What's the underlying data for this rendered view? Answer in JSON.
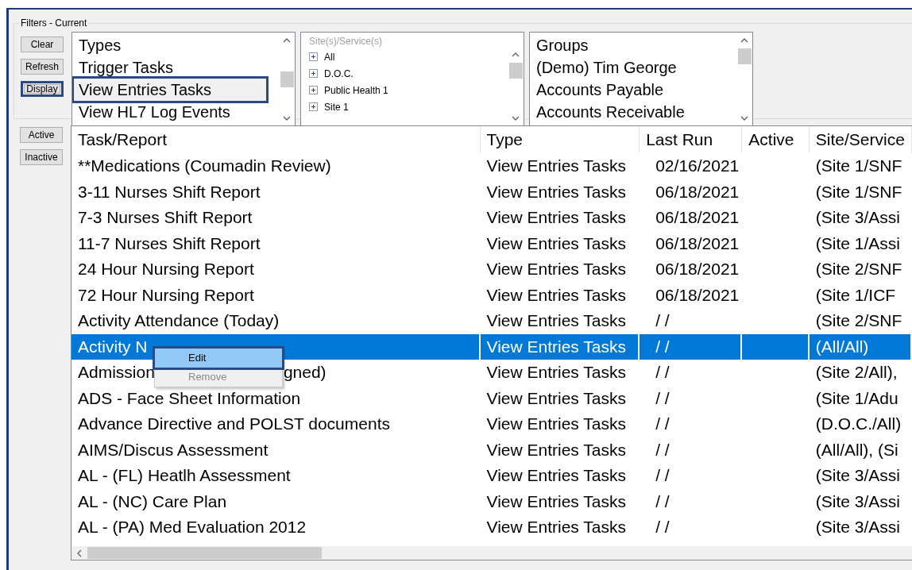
{
  "filters": {
    "title": "Filters - Current",
    "buttons": [
      {
        "label": "Clear",
        "highlighted": false
      },
      {
        "label": "Refresh",
        "highlighted": false
      },
      {
        "label": "Display",
        "highlighted": true
      }
    ],
    "types": {
      "header": "Types",
      "items": [
        {
          "label": "Trigger Tasks",
          "selected": false
        },
        {
          "label": "View Entries Tasks",
          "selected": true
        },
        {
          "label": "View HL7 Log Events",
          "selected": false
        }
      ]
    },
    "sites": {
      "header": "Site(s)/Service(s)",
      "items": [
        "All",
        "D.O.C.",
        "Public Health 1",
        "Site 1"
      ]
    },
    "groups": {
      "header": "Groups",
      "items": [
        "(Demo) Tim George",
        "Accounts Payable",
        "Accounts Receivable"
      ]
    }
  },
  "status_buttons": [
    "Active",
    "Inactive"
  ],
  "table": {
    "columns": [
      "Task/Report",
      "Type",
      "Last Run",
      "Active",
      "Site/Service"
    ],
    "rows": [
      {
        "task": "**Medications (Coumadin Review)",
        "type": "View Entries Tasks",
        "last_run": "02/16/2021",
        "site": "(Site 1/SNF",
        "selected": false
      },
      {
        "task": "3-11 Nurses Shift Report",
        "type": "View Entries Tasks",
        "last_run": "06/18/2021",
        "site": "(Site 1/SNF",
        "selected": false
      },
      {
        "task": "7-3 Nurses Shift Report",
        "type": "View Entries Tasks",
        "last_run": "06/18/2021",
        "site": "(Site 3/Assi",
        "selected": false
      },
      {
        "task": "11-7 Nurses Shift Report",
        "type": "View Entries Tasks",
        "last_run": "06/18/2021",
        "site": "(Site 1/Assi",
        "selected": false
      },
      {
        "task": "24 Hour Nursing Report",
        "type": "View Entries Tasks",
        "last_run": "06/18/2021",
        "site": "(Site 2/SNF",
        "selected": false
      },
      {
        "task": "72 Hour Nursing Report",
        "type": "View Entries Tasks",
        "last_run": "06/18/2021",
        "site": "(Site 1/ICF",
        "selected": false
      },
      {
        "task": "Activity Attendance (Today)",
        "type": "View Entries Tasks",
        "last_run": "/  /",
        "site": "(Site 2/SNF",
        "selected": false
      },
      {
        "task": "Activity N",
        "type": "View Entries Tasks",
        "last_run": "/  /",
        "site": "(All/All)",
        "selected": true
      },
      {
        "task": "Admission",
        "task_tail": "gned)",
        "type": "View Entries Tasks",
        "last_run": "/  /",
        "site": "(Site 2/All),",
        "selected": false
      },
      {
        "task": "ADS - Face Sheet Information",
        "type": "View Entries Tasks",
        "last_run": "/  /",
        "site": "(Site 1/Adu",
        "selected": false
      },
      {
        "task": "Advance Directive and POLST documents",
        "type": "View Entries Tasks",
        "last_run": "/  /",
        "site": "(D.O.C./All)",
        "selected": false
      },
      {
        "task": "AIMS/Discus Assessment",
        "type": "View Entries Tasks",
        "last_run": "/  /",
        "site": "(All/All), (Si",
        "selected": false
      },
      {
        "task": "AL - (FL) Heatlh Assessment",
        "type": "View Entries Tasks",
        "last_run": "/  /",
        "site": "(Site 3/Assi",
        "selected": false
      },
      {
        "task": "AL - (NC) Care Plan",
        "type": "View Entries Tasks",
        "last_run": "/  /",
        "site": "(Site 3/Assi",
        "selected": false
      },
      {
        "task": "AL - (PA) Med Evaluation 2012",
        "type": "View Entries Tasks",
        "last_run": "/  /",
        "site": "(Site 3/Assi",
        "selected": false
      }
    ]
  },
  "context_menu": [
    {
      "label": "Edit",
      "selected": true,
      "disabled": false
    },
    {
      "label": "Remove",
      "selected": false,
      "disabled": true
    }
  ]
}
